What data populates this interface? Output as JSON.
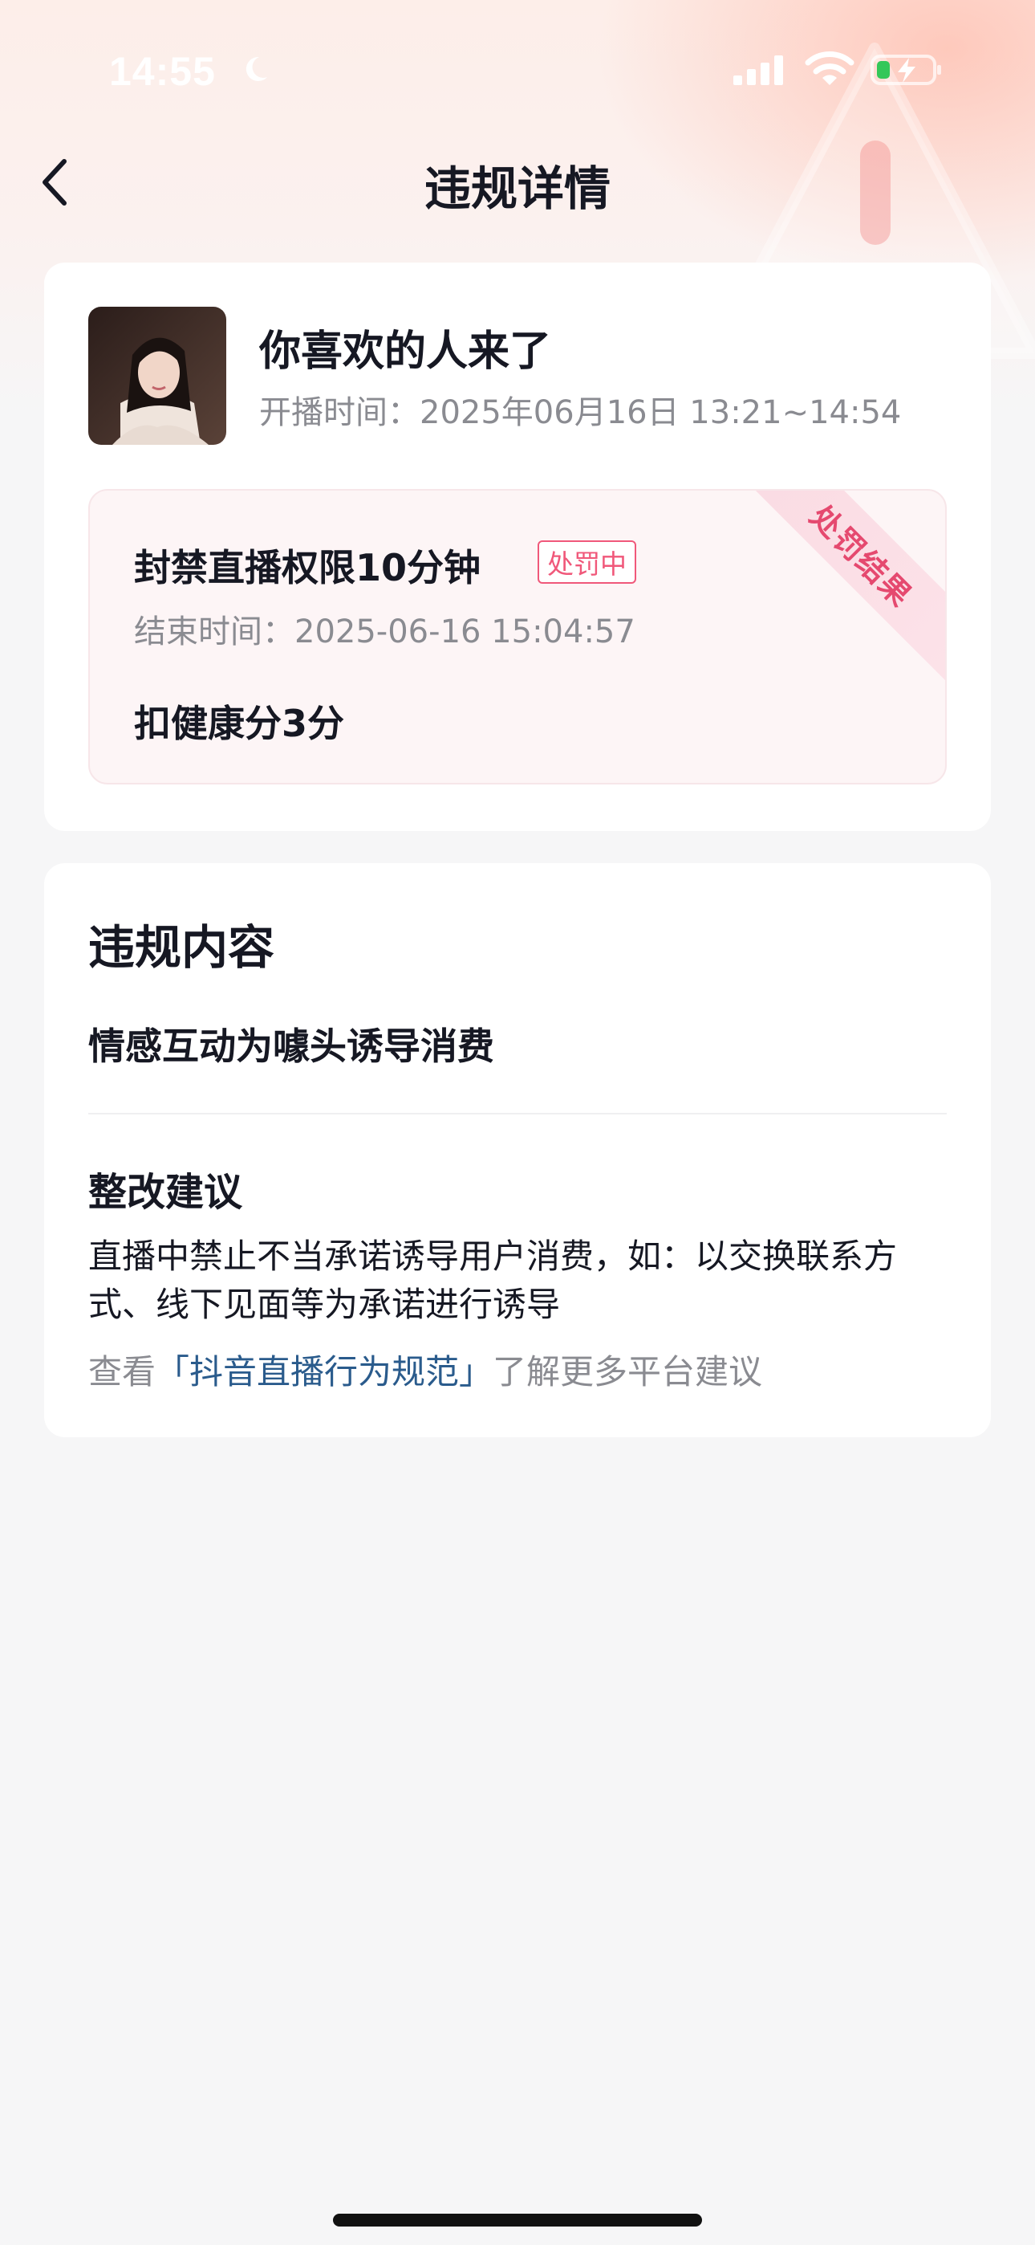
{
  "status_bar": {
    "time": "14:55",
    "icons": [
      "moon-icon",
      "signal-icon",
      "wifi-icon",
      "battery-icon"
    ]
  },
  "nav": {
    "back_icon": "chevron-left-icon",
    "title": "违规详情"
  },
  "stream_info": {
    "name": "你喜欢的人来了",
    "time_label": "开播时间：",
    "time_value": "2025年06月16日 13:21~14:54"
  },
  "penalty": {
    "ribbon": "处罚结果",
    "title": "封禁直播权限10分钟",
    "status_tag": "处罚中",
    "end_time_label": "结束时间：",
    "end_time_value": "2025-06-16 15:04:57",
    "health_deduction": "扣健康分3分"
  },
  "violation": {
    "section_title": "违规内容",
    "content": "情感互动为噱头诱导消费"
  },
  "advice": {
    "title": "整改建议",
    "body": "直播中禁止不当承诺诱导用户消费，如：以交换联系方式、线下见面等为承诺进行诱导",
    "rules_prefix": "查看",
    "rules_link": "「抖音直播行为规范」",
    "rules_suffix": "了解更多平台建议"
  },
  "colors": {
    "accent_pink": "#f0587a",
    "link_blue": "#2a5b8c",
    "text_primary": "#161823",
    "text_secondary": "#8a8b91",
    "page_bg": "#f6f6f7"
  }
}
